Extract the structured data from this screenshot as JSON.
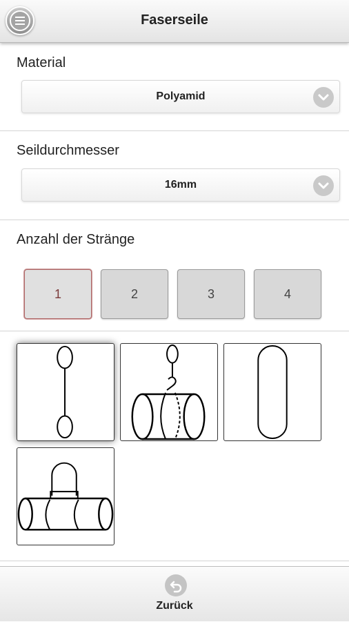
{
  "header": {
    "title": "Faserseile",
    "menu_icon": "menu-icon"
  },
  "material": {
    "label": "Material",
    "value": "Polyamid"
  },
  "diameter": {
    "label": "Seildurchmesser",
    "value": "16mm"
  },
  "strands": {
    "label": "Anzahl der Stränge",
    "options": [
      "1",
      "2",
      "3",
      "4"
    ],
    "selected": "1"
  },
  "attachment_types": [
    "straight-sling-icon",
    "choke-hitch-icon",
    "loop-sling-icon",
    "basket-hitch-icon"
  ],
  "footer": {
    "back_label": "Zurück",
    "back_icon": "back-arrow-icon"
  }
}
